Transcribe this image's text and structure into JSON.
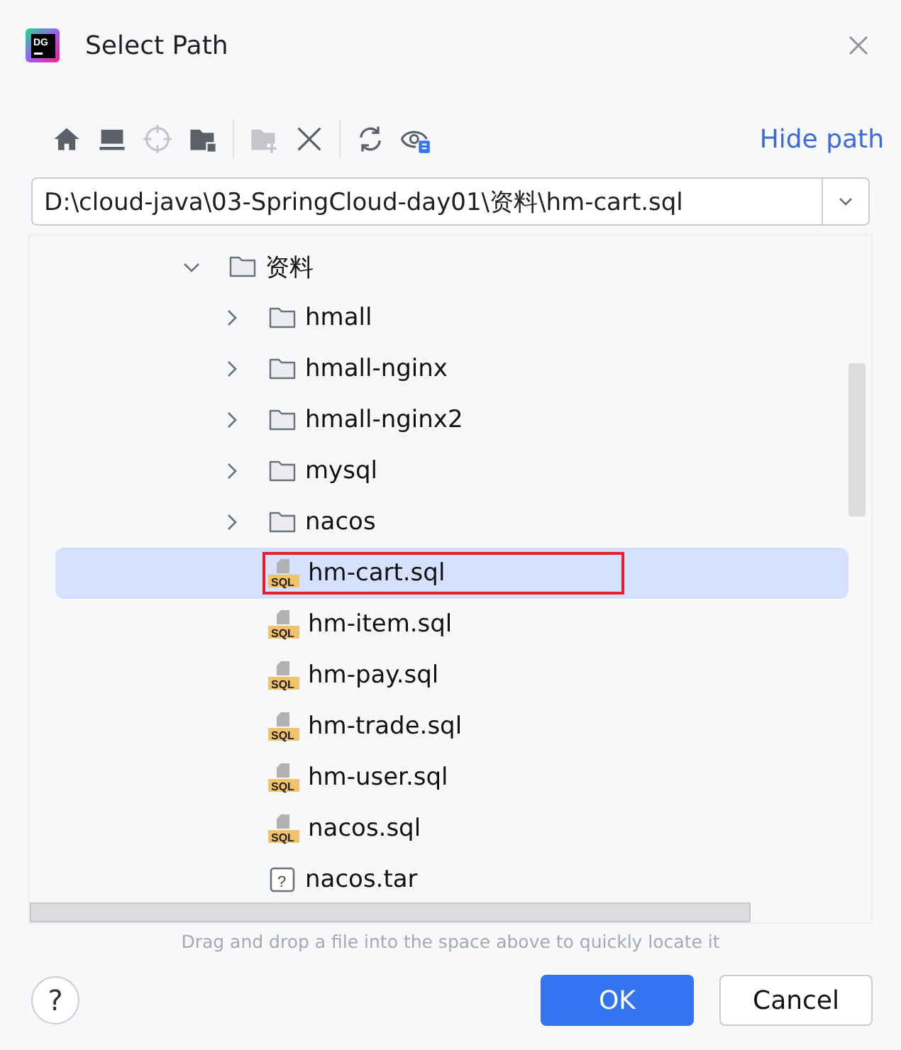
{
  "window": {
    "title": "Select Path",
    "logo_text": "DG"
  },
  "toolbar": [
    {
      "kind": "home",
      "disabled": false
    },
    {
      "kind": "desktop",
      "disabled": false
    },
    {
      "kind": "target",
      "disabled": true
    },
    {
      "kind": "folder-module",
      "disabled": false
    },
    {
      "kind": "separator"
    },
    {
      "kind": "new-folder",
      "disabled": true
    },
    {
      "kind": "delete",
      "disabled": false
    },
    {
      "kind": "separator"
    },
    {
      "kind": "refresh",
      "disabled": false
    },
    {
      "kind": "show-hidden",
      "disabled": false
    }
  ],
  "hide_path_link": "Hide path",
  "path_field": {
    "value": "D:\\cloud-java\\03-SpringCloud-day01\\资料\\hm-cart.sql"
  },
  "tree": [
    {
      "label": "资料",
      "kind": "folder",
      "expanded": true,
      "selected": false,
      "children": [
        {
          "label": "hmall",
          "kind": "folder",
          "expanded": false,
          "selected": false
        },
        {
          "label": "hmall-nginx",
          "kind": "folder",
          "expanded": false,
          "selected": false
        },
        {
          "label": "hmall-nginx2",
          "kind": "folder",
          "expanded": false,
          "selected": false
        },
        {
          "label": "mysql",
          "kind": "folder",
          "expanded": false,
          "selected": false
        },
        {
          "label": "nacos",
          "kind": "folder",
          "expanded": false,
          "selected": false
        },
        {
          "label": "hm-cart.sql",
          "kind": "sql",
          "icon_text": "SQL",
          "selected": true,
          "annotated": true
        },
        {
          "label": "hm-item.sql",
          "kind": "sql",
          "icon_text": "SQL",
          "selected": false,
          "annotated": false
        },
        {
          "label": "hm-pay.sql",
          "kind": "sql",
          "icon_text": "SQL",
          "selected": false,
          "annotated": false
        },
        {
          "label": "hm-trade.sql",
          "kind": "sql",
          "icon_text": "SQL",
          "selected": false,
          "annotated": false
        },
        {
          "label": "hm-user.sql",
          "kind": "sql",
          "icon_text": "SQL",
          "selected": false,
          "annotated": false
        },
        {
          "label": "nacos.sql",
          "kind": "sql",
          "icon_text": "SQL",
          "selected": false,
          "annotated": false
        },
        {
          "label": "nacos.tar",
          "kind": "unknown",
          "icon_text": "?",
          "selected": false,
          "annotated": false
        }
      ]
    }
  ],
  "hint": "Drag and drop a file into the space above to quickly locate it",
  "help_button": "?",
  "buttons": [
    {
      "label": "OK",
      "kind": "primary"
    },
    {
      "label": "Cancel",
      "kind": "secondary"
    }
  ]
}
